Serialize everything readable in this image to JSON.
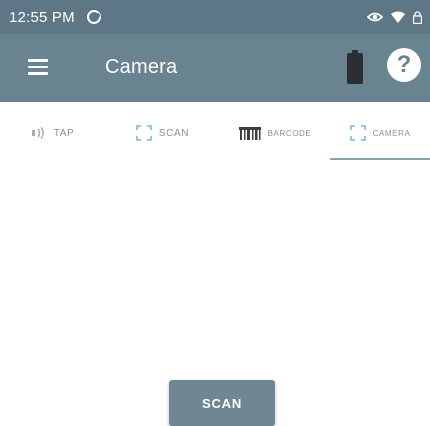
{
  "status_bar": {
    "time": "12:55 PM",
    "icons": [
      "app-notification-icon",
      "eye-icon",
      "wifi-icon",
      "lock-icon"
    ]
  },
  "app_bar": {
    "title": "Camera",
    "icons": [
      "menu-icon",
      "battery-icon",
      "help-icon"
    ],
    "help_glyph": "?"
  },
  "tabs": [
    {
      "label": "TAP",
      "icon": "nfc-tap-icon",
      "active": false
    },
    {
      "label": "SCAN",
      "icon": "scan-frame-icon",
      "active": false
    },
    {
      "label": "BARCODE",
      "icon": "barcode-icon",
      "active": false
    },
    {
      "label": "CAMERA",
      "icon": "camera-frame-icon",
      "active": true
    }
  ],
  "scan_button": {
    "label": "SCAN"
  },
  "colors": {
    "status_bar": "#5e7786",
    "app_bar": "#6a8390",
    "button": "#6f8793",
    "tab_text": "#8a8f93",
    "tab_underline": "#8da3ae"
  }
}
